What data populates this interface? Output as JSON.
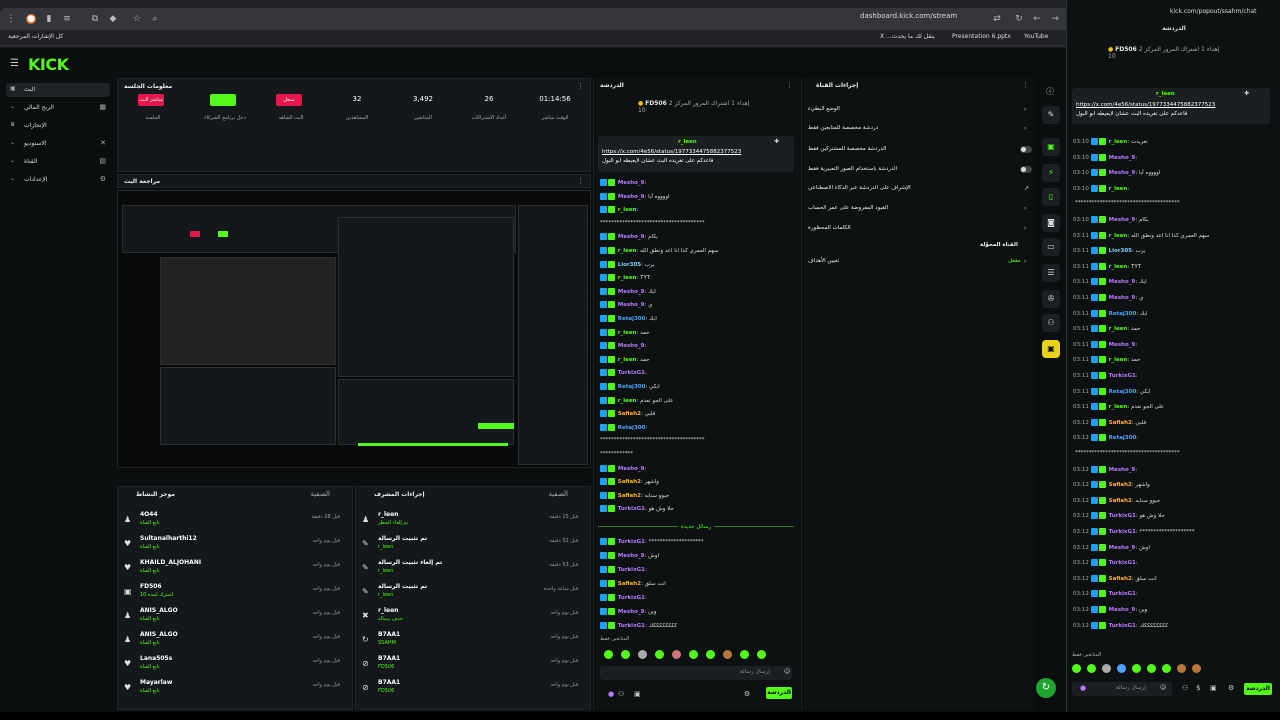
{
  "browser": {
    "url": "dashboard.kick.com/stream",
    "popout_url": "kick.com/popout/ssahm/chat",
    "bookmarks": [
      "كل الإشارات المرجعية",
      "X ...يتقل لك ما يحدث",
      "Presentation 6.pptx",
      "YouTube"
    ]
  },
  "app": {
    "logo": "KICK"
  },
  "nav": [
    {
      "label": "البث",
      "active": true
    },
    {
      "label": "الربح المالي",
      "active": false
    },
    {
      "label": "الإنجازات",
      "active": false
    },
    {
      "label": "الاستوديو",
      "active": false
    },
    {
      "label": "القناة",
      "active": false
    },
    {
      "label": "الإعدادات",
      "active": false
    }
  ],
  "session": {
    "title": "معلومات الجلسة",
    "stats": [
      {
        "value": "01:14:56",
        "label": "الوقت مباشر"
      },
      {
        "value": "26",
        "label": "أعداد الاشتراكات"
      },
      {
        "value": "3,492",
        "label": "المتابعين"
      },
      {
        "value": "32",
        "label": "المشاهدين"
      },
      {
        "value": "",
        "label": "البث الشاهد",
        "badge": "سجل",
        "badge_color": "#e4184a"
      },
      {
        "value": "",
        "label": "دخل برنامج الشركاء",
        "badge": "",
        "badge_color": "#53fc18"
      },
      {
        "value": "",
        "label": "الجلسة",
        "badge": "مباشر البث",
        "badge_color": "#e4184a"
      }
    ]
  },
  "preview": {
    "title": "مراجعة البث"
  },
  "activity": {
    "title": "موجز النشاط",
    "filter": "الصفية",
    "items": [
      {
        "name": "4O44",
        "sub": "تابع القناة",
        "time": "قبل 28 دقيقة",
        "icon": "person-icon"
      },
      {
        "name": "Sultanalharthi12",
        "sub": "تابع القناة",
        "time": "قبل يوم واحد",
        "icon": "heart-icon"
      },
      {
        "name": "KHAILD_ALJOHANI",
        "sub": "تابع القناة",
        "time": "قبل يوم واحد",
        "icon": "heart-icon"
      },
      {
        "name": "FD506",
        "sub": "اشترك لمدة 10",
        "time": "قبل يوم واحد",
        "icon": "gift-icon"
      },
      {
        "name": "ANIS_ALGO",
        "sub": "تابع القناة",
        "time": "قبل يوم واحد",
        "icon": "person-icon"
      },
      {
        "name": "ANIS_ALGO",
        "sub": "تابع القناة",
        "time": "قبل يوم واحد",
        "icon": "person-icon"
      },
      {
        "name": "Lana505s",
        "sub": "تابع القناة",
        "time": "قبل يوم واحد",
        "icon": "heart-icon"
      },
      {
        "name": "Mayarlaw",
        "sub": "تابع القناة",
        "time": "قبل يوم واحد",
        "icon": "heart-icon"
      }
    ]
  },
  "modlog": {
    "title": "إجراءات المشرف",
    "filter": "الصفية",
    "items": [
      {
        "name": "r_leen",
        "sub": "تم إلغاء الحظر",
        "time": "قبل 15 دقيقة",
        "icon": "person-icon"
      },
      {
        "name": "تم تثبيت الرسالة",
        "sub": "r_leen",
        "time": "قبل 52 دقيقة",
        "icon": "pin-icon"
      },
      {
        "name": "تم إلغاء تثبيت الرسالة",
        "sub": "r_leen",
        "time": "قبل 53 دقيقة",
        "icon": "pin-icon"
      },
      {
        "name": "تم تثبيت الرسالة",
        "sub": "r_leen",
        "time": "قبل ساعة واحدة",
        "icon": "pin-icon"
      },
      {
        "name": "r_leen",
        "sub": "حذف رسالة",
        "time": "قبل يوم واحد",
        "icon": "trash-icon"
      },
      {
        "name": "B7AA1",
        "sub": "SSAHM",
        "time": "قبل يوم واحد",
        "icon": "refresh-icon"
      },
      {
        "name": "B7AA1",
        "sub": "FD506",
        "time": "قبل يوم واحد",
        "icon": "ban-icon"
      },
      {
        "name": "B7AA1",
        "sub": "FD506",
        "time": "قبل يوم واحد",
        "icon": "ban-icon"
      }
    ]
  },
  "chat": {
    "title": "الدردشة",
    "gift_user": "FD506",
    "gift_count": "10",
    "gift_text": "إهداء 1 اشتراك المرور المركز 2",
    "pinned_user": "r_leen",
    "pinned_link": "https://x.com/4e56/status/1977334475882377523",
    "pinned_text": "قاعدكم على تغريده البث عشان لايعيطه ابو البول",
    "new_msgs_label": "رسائل جديدة",
    "input_placeholder": "إرسال رسالة",
    "send_label": "الدردشة",
    "viewers_label": "المتابعين فقط",
    "messages": [
      {
        "user": "Mesho_9",
        "color": "#b97cff",
        "text": ""
      },
      {
        "user": "Mesho_9",
        "color": "#b97cff",
        "text": "اووووه آيا"
      },
      {
        "user": "r_leen",
        "color": "#53fc18",
        "text": ""
      },
      {
        "user": "",
        "color": "#ddd",
        "text": "**************************************"
      },
      {
        "user": "Mesho_9",
        "color": "#b97cff",
        "text": "بكام"
      },
      {
        "user": "r_leen",
        "color": "#53fc18",
        "text": "سهم العمري كذا انا اعد ونطق الله"
      },
      {
        "user": "Lior305",
        "color": "#7fd1ff",
        "text": "يرب"
      },
      {
        "user": "r_leen",
        "color": "#53fc18",
        "text": "TYT"
      },
      {
        "user": "Mesho_9",
        "color": "#b97cff",
        "text": "ابك"
      },
      {
        "user": "Mesho_9",
        "color": "#b97cff",
        "text": "ي"
      },
      {
        "user": "Retaj300",
        "color": "#4da3ff",
        "text": "ابك"
      },
      {
        "user": "r_leen",
        "color": "#53fc18",
        "text": "حمد"
      },
      {
        "user": "Mesho_9",
        "color": "#b97cff",
        "text": ""
      },
      {
        "user": "r_leen",
        "color": "#53fc18",
        "text": "حمد"
      },
      {
        "user": "TurkixG1",
        "color": "#b97cff",
        "text": ""
      },
      {
        "user": "Retaj300",
        "color": "#4da3ff",
        "text": "ابكي"
      },
      {
        "user": "r_leen",
        "color": "#53fc18",
        "text": "على الجو تعدم"
      },
      {
        "user": "Safiah2",
        "color": "#ffb02e",
        "text": "قلبي"
      },
      {
        "user": "Retaj300",
        "color": "#4da3ff",
        "text": ""
      },
      {
        "user": "",
        "color": "#ddd",
        "text": "**************************************"
      },
      {
        "user": "",
        "color": "#ddd",
        "text": "************"
      },
      {
        "user": "Mesho_9",
        "color": "#b97cff",
        "text": ""
      },
      {
        "user": "Safiah2",
        "color": "#ffb02e",
        "text": "واشهر"
      },
      {
        "user": "Safiah2",
        "color": "#ffb02e",
        "text": "حيوو سنايه"
      },
      {
        "user": "TurkixG1",
        "color": "#b97cff",
        "text": "حلا وش هو"
      }
    ],
    "new_messages": [
      {
        "user": "TurkixG1",
        "color": "#b97cff",
        "text": "********************"
      },
      {
        "user": "Mesho_9",
        "color": "#b97cff",
        "text": "اوش"
      },
      {
        "user": "TurkixG1",
        "color": "#b97cff",
        "text": ""
      },
      {
        "user": "Safiah2",
        "color": "#ffb02e",
        "text": "انت سلق"
      },
      {
        "user": "TurkixG1",
        "color": "#b97cff",
        "text": ""
      },
      {
        "user": "Mesho_9",
        "color": "#b97cff",
        "text": "وين"
      },
      {
        "user": "TurkixG1",
        "color": "#b97cff",
        "text": "ككككككككك"
      }
    ]
  },
  "modpanel": {
    "title": "إجراءات القناة",
    "rows": [
      {
        "label": "الوضع البطيء",
        "type": "arrow"
      },
      {
        "label": "دردشة مخصصة للمتابعين فقط",
        "type": "arrow"
      },
      {
        "label": "الدردشة مخصصة للمشتركين فقط",
        "type": "toggle"
      },
      {
        "label": "الدردشة باستخدام الصور التعبيرية فقط",
        "type": "toggle"
      },
      {
        "label": "الإشراف على الدردشة عبر الذكاء الاصطناعي",
        "type": "ext"
      },
      {
        "label": "القيود المفروضة على عمر الحساب",
        "type": "arrow"
      },
      {
        "label": "الكلمات المحظورة",
        "type": "arrow"
      }
    ],
    "channel_label": "القناة المحوّلة",
    "channel_status": "مقفل",
    "goals_label": "تعيين الأهداف"
  },
  "popout": {
    "title": "الدردشة",
    "messages": [
      {
        "ts": "03:10",
        "user": "r_leen",
        "color": "#53fc18",
        "text": "تغريدت"
      },
      {
        "ts": "03:10",
        "user": "Mesho_9",
        "color": "#b97cff",
        "text": ""
      },
      {
        "ts": "03:10",
        "user": "Mesho_9",
        "color": "#b97cff",
        "text": "اووووه آيا"
      },
      {
        "ts": "03:10",
        "user": "r_leen",
        "color": "#53fc18",
        "text": ""
      },
      {
        "ts": "",
        "user": "",
        "color": "#ddd",
        "text": "**************************************"
      },
      {
        "ts": "03:10",
        "user": "Mesho_9",
        "color": "#b97cff",
        "text": "بكام"
      },
      {
        "ts": "03:11",
        "user": "r_leen",
        "color": "#53fc18",
        "text": "سهم العمري كذا انا اعد ونطق الله"
      },
      {
        "ts": "03:11",
        "user": "Lior305",
        "color": "#7fd1ff",
        "text": "يرب"
      },
      {
        "ts": "03:11",
        "user": "r_leen",
        "color": "#53fc18",
        "text": "TYT"
      },
      {
        "ts": "03:11",
        "user": "Mesho_9",
        "color": "#b97cff",
        "text": "ابك"
      },
      {
        "ts": "03:11",
        "user": "Mesho_9",
        "color": "#b97cff",
        "text": "ي"
      },
      {
        "ts": "03:11",
        "user": "Retaj300",
        "color": "#4da3ff",
        "text": "ابك"
      },
      {
        "ts": "03:11",
        "user": "r_leen",
        "color": "#53fc18",
        "text": "حمد"
      },
      {
        "ts": "03:11",
        "user": "Mesho_9",
        "color": "#b97cff",
        "text": ""
      },
      {
        "ts": "03:11",
        "user": "r_leen",
        "color": "#53fc18",
        "text": "حمد"
      },
      {
        "ts": "03:11",
        "user": "TurkixG1",
        "color": "#b97cff",
        "text": ""
      },
      {
        "ts": "03:11",
        "user": "Retaj300",
        "color": "#4da3ff",
        "text": "ابكي"
      },
      {
        "ts": "03:11",
        "user": "r_leen",
        "color": "#53fc18",
        "text": "على الجو تعدم"
      },
      {
        "ts": "03:12",
        "user": "Safiah2",
        "color": "#ffb02e",
        "text": "قلبي"
      },
      {
        "ts": "03:12",
        "user": "Retaj300",
        "color": "#4da3ff",
        "text": ""
      },
      {
        "ts": "",
        "user": "",
        "color": "#ddd",
        "text": "**************************************"
      },
      {
        "ts": "03:12",
        "user": "Mesho_9",
        "color": "#b97cff",
        "text": ""
      },
      {
        "ts": "03:12",
        "user": "Safiah2",
        "color": "#ffb02e",
        "text": "واشهر"
      },
      {
        "ts": "03:12",
        "user": "Safiah2",
        "color": "#ffb02e",
        "text": "حيوو سنايه"
      },
      {
        "ts": "03:12",
        "user": "TurkixG1",
        "color": "#b97cff",
        "text": "حلا وش هو"
      },
      {
        "ts": "03:12",
        "user": "TurkixG1",
        "color": "#b97cff",
        "text": "********************"
      },
      {
        "ts": "03:12",
        "user": "Mesho_9",
        "color": "#b97cff",
        "text": "اوش"
      },
      {
        "ts": "03:12",
        "user": "TurkixG1",
        "color": "#b97cff",
        "text": ""
      },
      {
        "ts": "03:12",
        "user": "Safiah2",
        "color": "#ffb02e",
        "text": "انت سلق"
      },
      {
        "ts": "03:12",
        "user": "TurkixG1",
        "color": "#b97cff",
        "text": ""
      },
      {
        "ts": "03:12",
        "user": "Mesho_9",
        "color": "#b97cff",
        "text": "وين"
      },
      {
        "ts": "03:12",
        "user": "TurkixG1",
        "color": "#b97cff",
        "text": "ككككككككك"
      }
    ]
  }
}
